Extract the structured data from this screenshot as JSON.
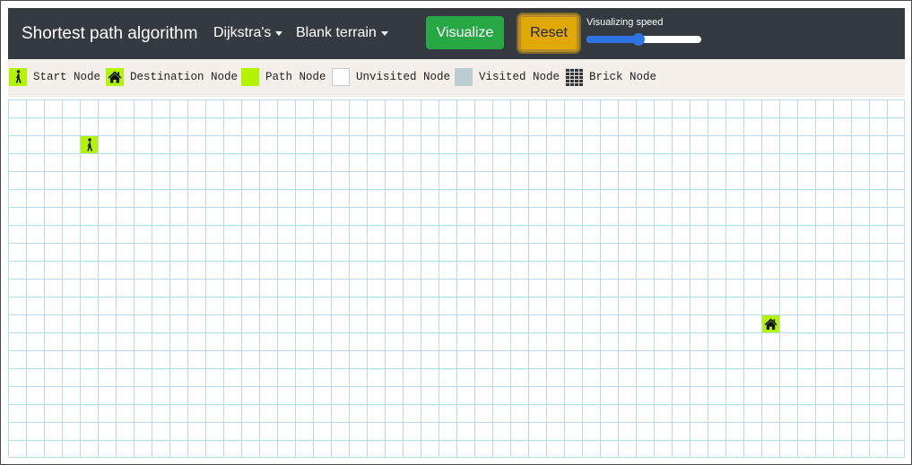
{
  "navbar": {
    "brand": "Shortest path algorithm",
    "algorithm_label": "Dijkstra's",
    "terrain_label": "Blank terrain",
    "visualize_label": "Visualize",
    "reset_label": "Reset",
    "speed_label": "Visualizing speed",
    "speed_value_fraction": 0.45
  },
  "legend": {
    "items": [
      {
        "label": "Start Node",
        "icon": "walking-person-icon"
      },
      {
        "label": "Destination Node",
        "icon": "house-icon"
      },
      {
        "label": "Path Node",
        "icon": "path-swatch"
      },
      {
        "label": "Unvisited Node",
        "icon": "unvisited-swatch"
      },
      {
        "label": "Visited Node",
        "icon": "visited-swatch"
      },
      {
        "label": "Brick Node",
        "icon": "brick-swatch"
      }
    ]
  },
  "grid": {
    "columns": 50,
    "rows": 20,
    "start": {
      "col": 4,
      "row": 2
    },
    "destination": {
      "col": 42,
      "row": 12
    }
  },
  "colors": {
    "navbar": "#343a40",
    "path_node": "#b5f400",
    "visited_node": "#b9cdd2",
    "grid_line": "#b7dcee",
    "visualize_button": "#28a745",
    "reset_button": "#e0a800",
    "slider": "#2f74e3"
  }
}
